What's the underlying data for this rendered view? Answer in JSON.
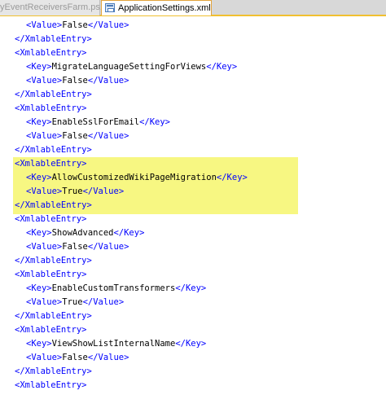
{
  "tabs": [
    {
      "label": "yEventReceiversFarm.ps1",
      "active": false
    },
    {
      "label": "ApplicationSettings.xml",
      "active": true
    }
  ],
  "colors": {
    "tag": "#0000ff",
    "text": "#000000",
    "highlight": "#f7f782",
    "active_tab_border": "#e2a33b"
  },
  "lines": [
    {
      "indent": 2,
      "open": "<Value>",
      "text": "False",
      "close": "</Value>"
    },
    {
      "indent": 1,
      "open": "</XmlableEntry>",
      "text": "",
      "close": ""
    },
    {
      "indent": 1,
      "open": "<XmlableEntry>",
      "text": "",
      "close": ""
    },
    {
      "indent": 2,
      "open": "<Key>",
      "text": "MigrateLanguageSettingForViews",
      "close": "</Key>"
    },
    {
      "indent": 2,
      "open": "<Value>",
      "text": "False",
      "close": "</Value>"
    },
    {
      "indent": 1,
      "open": "</XmlableEntry>",
      "text": "",
      "close": ""
    },
    {
      "indent": 1,
      "open": "<XmlableEntry>",
      "text": "",
      "close": ""
    },
    {
      "indent": 2,
      "open": "<Key>",
      "text": "EnableSslForEmail",
      "close": "</Key>"
    },
    {
      "indent": 2,
      "open": "<Value>",
      "text": "False",
      "close": "</Value>"
    },
    {
      "indent": 1,
      "open": "</XmlableEntry>",
      "text": "",
      "close": ""
    },
    {
      "indent": 1,
      "open": "<XmlableEntry>",
      "text": "",
      "close": ""
    },
    {
      "indent": 2,
      "open": "<Key>",
      "text": "AllowCustomizedWikiPageMigration",
      "close": "</Key>"
    },
    {
      "indent": 2,
      "open": "<Value>",
      "text": "True",
      "close": "</Value>"
    },
    {
      "indent": 1,
      "open": "</XmlableEntry>",
      "text": "",
      "close": ""
    },
    {
      "indent": 1,
      "open": "<XmlableEntry>",
      "text": "",
      "close": ""
    },
    {
      "indent": 2,
      "open": "<Key>",
      "text": "ShowAdvanced",
      "close": "</Key>"
    },
    {
      "indent": 2,
      "open": "<Value>",
      "text": "False",
      "close": "</Value>"
    },
    {
      "indent": 1,
      "open": "</XmlableEntry>",
      "text": "",
      "close": ""
    },
    {
      "indent": 1,
      "open": "<XmlableEntry>",
      "text": "",
      "close": ""
    },
    {
      "indent": 2,
      "open": "<Key>",
      "text": "EnableCustomTransformers",
      "close": "</Key>"
    },
    {
      "indent": 2,
      "open": "<Value>",
      "text": "True",
      "close": "</Value>"
    },
    {
      "indent": 1,
      "open": "</XmlableEntry>",
      "text": "",
      "close": ""
    },
    {
      "indent": 1,
      "open": "<XmlableEntry>",
      "text": "",
      "close": ""
    },
    {
      "indent": 2,
      "open": "<Key>",
      "text": "ViewShowListInternalName",
      "close": "</Key>"
    },
    {
      "indent": 2,
      "open": "<Value>",
      "text": "False",
      "close": "</Value>"
    },
    {
      "indent": 1,
      "open": "</XmlableEntry>",
      "text": "",
      "close": ""
    },
    {
      "indent": 1,
      "open": "<XmlableEntry>",
      "text": "",
      "close": ""
    }
  ]
}
